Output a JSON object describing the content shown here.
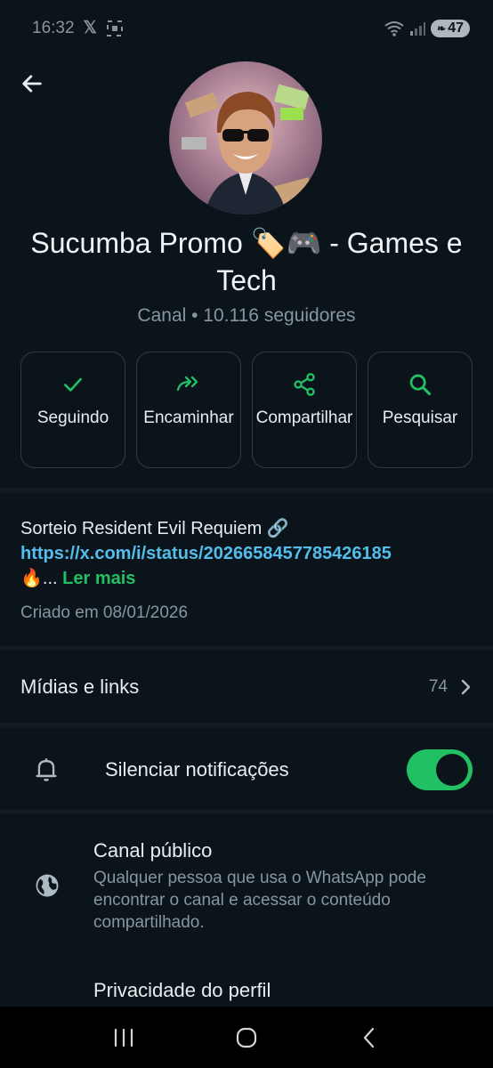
{
  "status_bar": {
    "time": "16:32",
    "battery": "47"
  },
  "header": {
    "back_icon": "arrow-left-icon",
    "title": "Sucumba Promo 🏷️🎮  - Games e Tech",
    "subtitle": "Canal • 10.116 seguidores"
  },
  "actions": [
    {
      "label": "Seguindo",
      "icon": "check-icon"
    },
    {
      "label": "Encaminhar",
      "icon": "forward-icon"
    },
    {
      "label": "Compartilhar",
      "icon": "share-icon"
    },
    {
      "label": "Pesquisar",
      "icon": "search-icon"
    }
  ],
  "description": {
    "text": "Sorteio Resident Evil Requiem 🔗",
    "link": "https://x.com/i/status/2026658457785426185",
    "tail": "🔥...",
    "more": "Ler mais",
    "created": "Criado em 08/01/2026"
  },
  "media": {
    "title": "Mídias e links",
    "count": "74"
  },
  "mute": {
    "title": "Silenciar notificações",
    "enabled": true
  },
  "public": {
    "title": "Canal público",
    "body": "Qualquer pessoa que usa o WhatsApp pode encontrar o canal e acessar o conteúdo compartilhado."
  },
  "privacy": {
    "title": "Privacidade do perfil"
  },
  "colors": {
    "accent": "#21c063",
    "link": "#53bdeb",
    "background": "#0b141a",
    "muted": "#8696a0"
  }
}
